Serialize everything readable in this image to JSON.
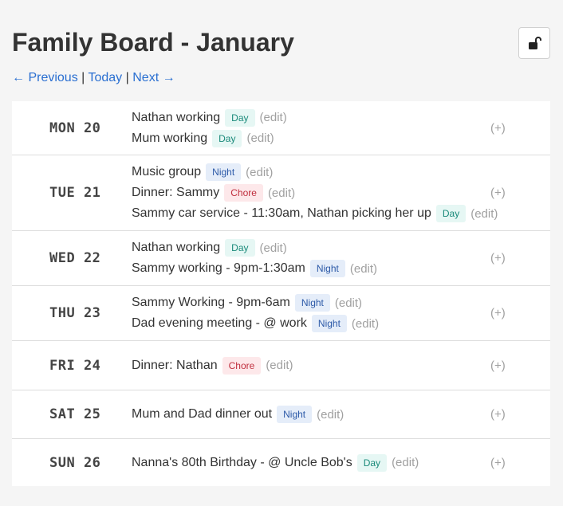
{
  "header": {
    "title": "Family Board - January",
    "lock_icon": "unlock-icon"
  },
  "nav": {
    "previous": "← Previous",
    "today": "Today",
    "next": "Next →",
    "separator": "|"
  },
  "badge_colors": {
    "Day": {
      "bg": "#e6f7f4",
      "fg": "#1a8a7a"
    },
    "Night": {
      "bg": "#e5edf9",
      "fg": "#2d5aa8"
    },
    "Chore": {
      "bg": "#fde8ea",
      "fg": "#c0303f"
    }
  },
  "edit_label": "(edit)",
  "add_label": "(+)",
  "days": [
    {
      "label": "MON 20",
      "events": [
        {
          "text": "Nathan working",
          "tag": "Day"
        },
        {
          "text": "Mum working",
          "tag": "Day"
        }
      ]
    },
    {
      "label": "TUE 21",
      "events": [
        {
          "text": "Music group",
          "tag": "Night"
        },
        {
          "text": "Dinner: Sammy",
          "tag": "Chore"
        },
        {
          "text": "Sammy car service - 11:30am, Nathan picking her up",
          "tag": "Day"
        }
      ]
    },
    {
      "label": "WED 22",
      "events": [
        {
          "text": "Nathan working",
          "tag": "Day"
        },
        {
          "text": "Sammy working - 9pm-1:30am",
          "tag": "Night"
        }
      ]
    },
    {
      "label": "THU 23",
      "events": [
        {
          "text": "Sammy Working - 9pm-6am",
          "tag": "Night"
        },
        {
          "text": "Dad evening meeting - @ work",
          "tag": "Night"
        }
      ]
    },
    {
      "label": "FRI 24",
      "events": [
        {
          "text": "Dinner: Nathan",
          "tag": "Chore"
        }
      ]
    },
    {
      "label": "SAT 25",
      "events": [
        {
          "text": "Mum and Dad dinner out",
          "tag": "Night"
        }
      ]
    },
    {
      "label": "SUN 26",
      "events": [
        {
          "text": "Nanna's 80th Birthday - @ Uncle Bob's",
          "tag": "Day"
        }
      ]
    }
  ]
}
